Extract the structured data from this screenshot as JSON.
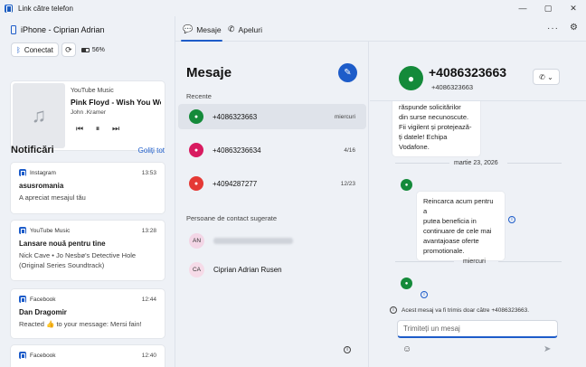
{
  "window": {
    "title": "Link către telefon"
  },
  "device": {
    "name": "iPhone - Ciprian Adrian",
    "connect_label": "Conectat",
    "battery_text": "56%",
    "battery_level": 0.56
  },
  "media": {
    "source": "YouTube Music",
    "title": "Pink Floyd - Wish You Wer...",
    "artist": "John .Kramer"
  },
  "notifications": {
    "title": "Notificări",
    "clear_label": "Goliți tot",
    "items": [
      {
        "app": "Instagram",
        "time": "13:53",
        "title": "asusromania",
        "body": "A apreciat mesajul tău"
      },
      {
        "app": "YouTube Music",
        "time": "13:28",
        "title": "Lansare nouă pentru tine",
        "body": "Nick Cave • Jo Nesbø's Detective Hole (Original Series Soundtrack)"
      },
      {
        "app": "Facebook",
        "time": "12:44",
        "title": "Dan Dragomir",
        "body": "Reacted 👍 to your message: Mersi fain!"
      },
      {
        "app": "Facebook",
        "time": "12:40",
        "title": "",
        "body": ""
      }
    ]
  },
  "nav": {
    "tabs": [
      {
        "label": "Mesaje"
      },
      {
        "label": "Apeluri"
      }
    ]
  },
  "messages": {
    "title": "Mesaje",
    "recent_label": "Recente",
    "conversations": [
      {
        "name": "+4086323663",
        "date": "miercuri",
        "color": "#148a3a"
      },
      {
        "name": "+40863236634",
        "date": "4/16",
        "color": "#d81b60"
      },
      {
        "name": "+4094287277",
        "date": "12/23",
        "color": "#e53935"
      }
    ],
    "suggested_label": "Persoane de contact sugerate",
    "contacts": [
      {
        "initials": "AN",
        "name": "",
        "color": "#f3d6e6"
      },
      {
        "initials": "CA",
        "name": "Ciprian Adrian Rusen",
        "color": "#f6dbe8"
      }
    ]
  },
  "conversation": {
    "name": "+4086323663",
    "number": "+4086323663",
    "bubble1_lines": [
      "răspunde solicitărilor",
      "din surse necunoscute.",
      "Fii vigilent și protejează-",
      "ți datele! Echipa",
      "Vodafone."
    ],
    "date_divider": "martie 23, 2026",
    "bubble2_lines": [
      "Reincarca acum pentru a",
      "putea beneficia in",
      "continuare de cele mai",
      "avantajoase oferte",
      "promotionale."
    ],
    "day_divider": "miercuri",
    "sms_notice": "Acest mesaj va fi trimis doar către +4086323663.",
    "input_placeholder": "Trimiteți un mesaj"
  }
}
